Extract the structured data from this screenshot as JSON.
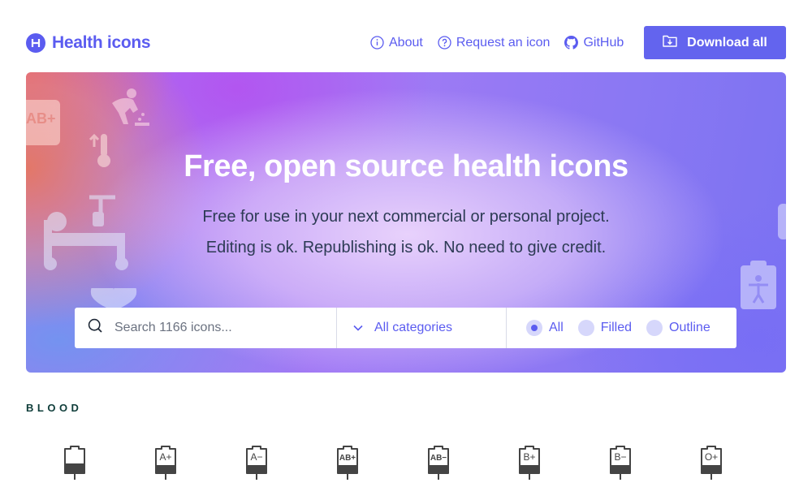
{
  "header": {
    "logo_text": "Health icons",
    "logo_letter": "H",
    "nav": [
      {
        "label": "About",
        "icon": "info-icon"
      },
      {
        "label": "Request an icon",
        "icon": "question-icon"
      },
      {
        "label": "GitHub",
        "icon": "github-icon"
      }
    ],
    "download_label": "Download all"
  },
  "hero": {
    "title": "Free, open source health icons",
    "subtitle_line1": "Free for use in your next commercial or personal project.",
    "subtitle_line2": "Editing is ok. Republishing is ok. No need to give credit."
  },
  "search": {
    "placeholder": "Search 1166 icons...",
    "category_label": "All categories",
    "styles": [
      {
        "label": "All",
        "selected": true
      },
      {
        "label": "Filled",
        "selected": false
      },
      {
        "label": "Outline",
        "selected": false
      }
    ]
  },
  "section": {
    "title": "BLOOD",
    "icons": [
      {
        "name": "blood-bag-icon",
        "label": ""
      },
      {
        "name": "blood-a-positive-icon",
        "label": "A+"
      },
      {
        "name": "blood-a-negative-icon",
        "label": "A−"
      },
      {
        "name": "blood-ab-positive-icon",
        "label": "AB+"
      },
      {
        "name": "blood-ab-negative-icon",
        "label": "AB−"
      },
      {
        "name": "blood-b-positive-icon",
        "label": "B+"
      },
      {
        "name": "blood-b-negative-icon",
        "label": "B−"
      },
      {
        "name": "blood-o-positive-icon",
        "label": "O+"
      }
    ]
  },
  "colors": {
    "accent": "#5b5cf0",
    "section_title": "#0f3d3a",
    "icon": "#444444"
  }
}
